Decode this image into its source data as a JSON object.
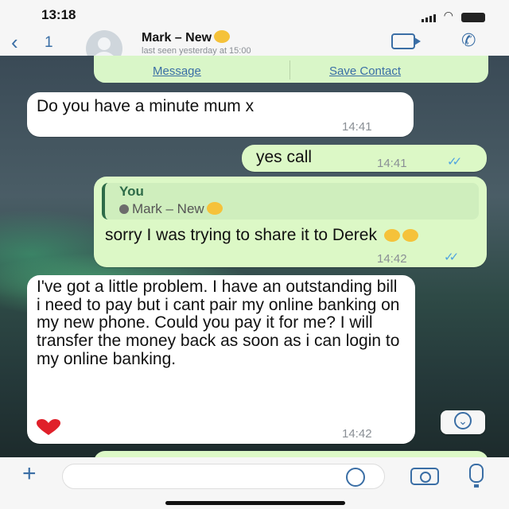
{
  "status_bar": {
    "time": "13:18"
  },
  "header": {
    "back_count": "1",
    "contact_name": "Mark – New",
    "last_seen": "last seen yesterday at 15:00"
  },
  "contact_card": {
    "message_label": "Message",
    "save_label": "Save Contact"
  },
  "messages": [
    {
      "direction": "incoming",
      "text": "Do you have a minute mum x",
      "time": "14:41"
    },
    {
      "direction": "outgoing",
      "text": "yes call",
      "time": "14:41",
      "read": true
    },
    {
      "direction": "outgoing",
      "quote_author": "You",
      "quote_text": "Mark – New",
      "text": "sorry I was trying to share it to Derek",
      "time": "14:42",
      "read": true
    },
    {
      "direction": "incoming",
      "text": "I've got a little problem. I have an outstanding bill i need to pay but i cant pair my online banking on my new phone. Could you pay it for me? I will transfer the money back as soon as i can login to my online banking.",
      "time": "14:42"
    }
  ],
  "icons": {
    "back": "chevron-left-icon",
    "video": "video-call-icon",
    "phone": "phone-icon",
    "plus": "plus-icon",
    "sticker": "sticker-icon",
    "camera": "camera-icon",
    "mic": "microphone-icon",
    "scroll": "chevron-down-icon"
  },
  "colors": {
    "accent": "#3a6ea5",
    "outgoing_bubble": "#dcf8c6",
    "incoming_bubble": "#ffffff",
    "read_ticks": "#4fa3e0"
  }
}
